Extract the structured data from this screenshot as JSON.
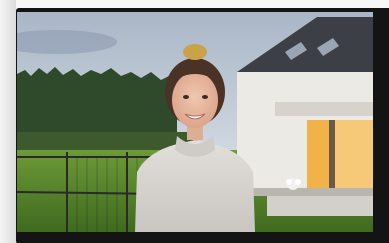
{
  "scene": {
    "device": "video-doorbell-monitor",
    "subject": "smiling-woman",
    "setting": "modern-house-exterior-with-lawn-and-forest"
  },
  "colors": {
    "bezel": "#141414",
    "sky_top": "#a9b6c6",
    "sky_bottom": "#e6ebf0",
    "forest": "#2f4a2a",
    "lawn": "#5c8a2e",
    "sweater": "#d9d6d2",
    "hair": "#4a3226",
    "skin": "#e7b9a0",
    "roof": "#3c3f45",
    "wall": "#eceae5",
    "door_glow": "#f2b24a"
  }
}
